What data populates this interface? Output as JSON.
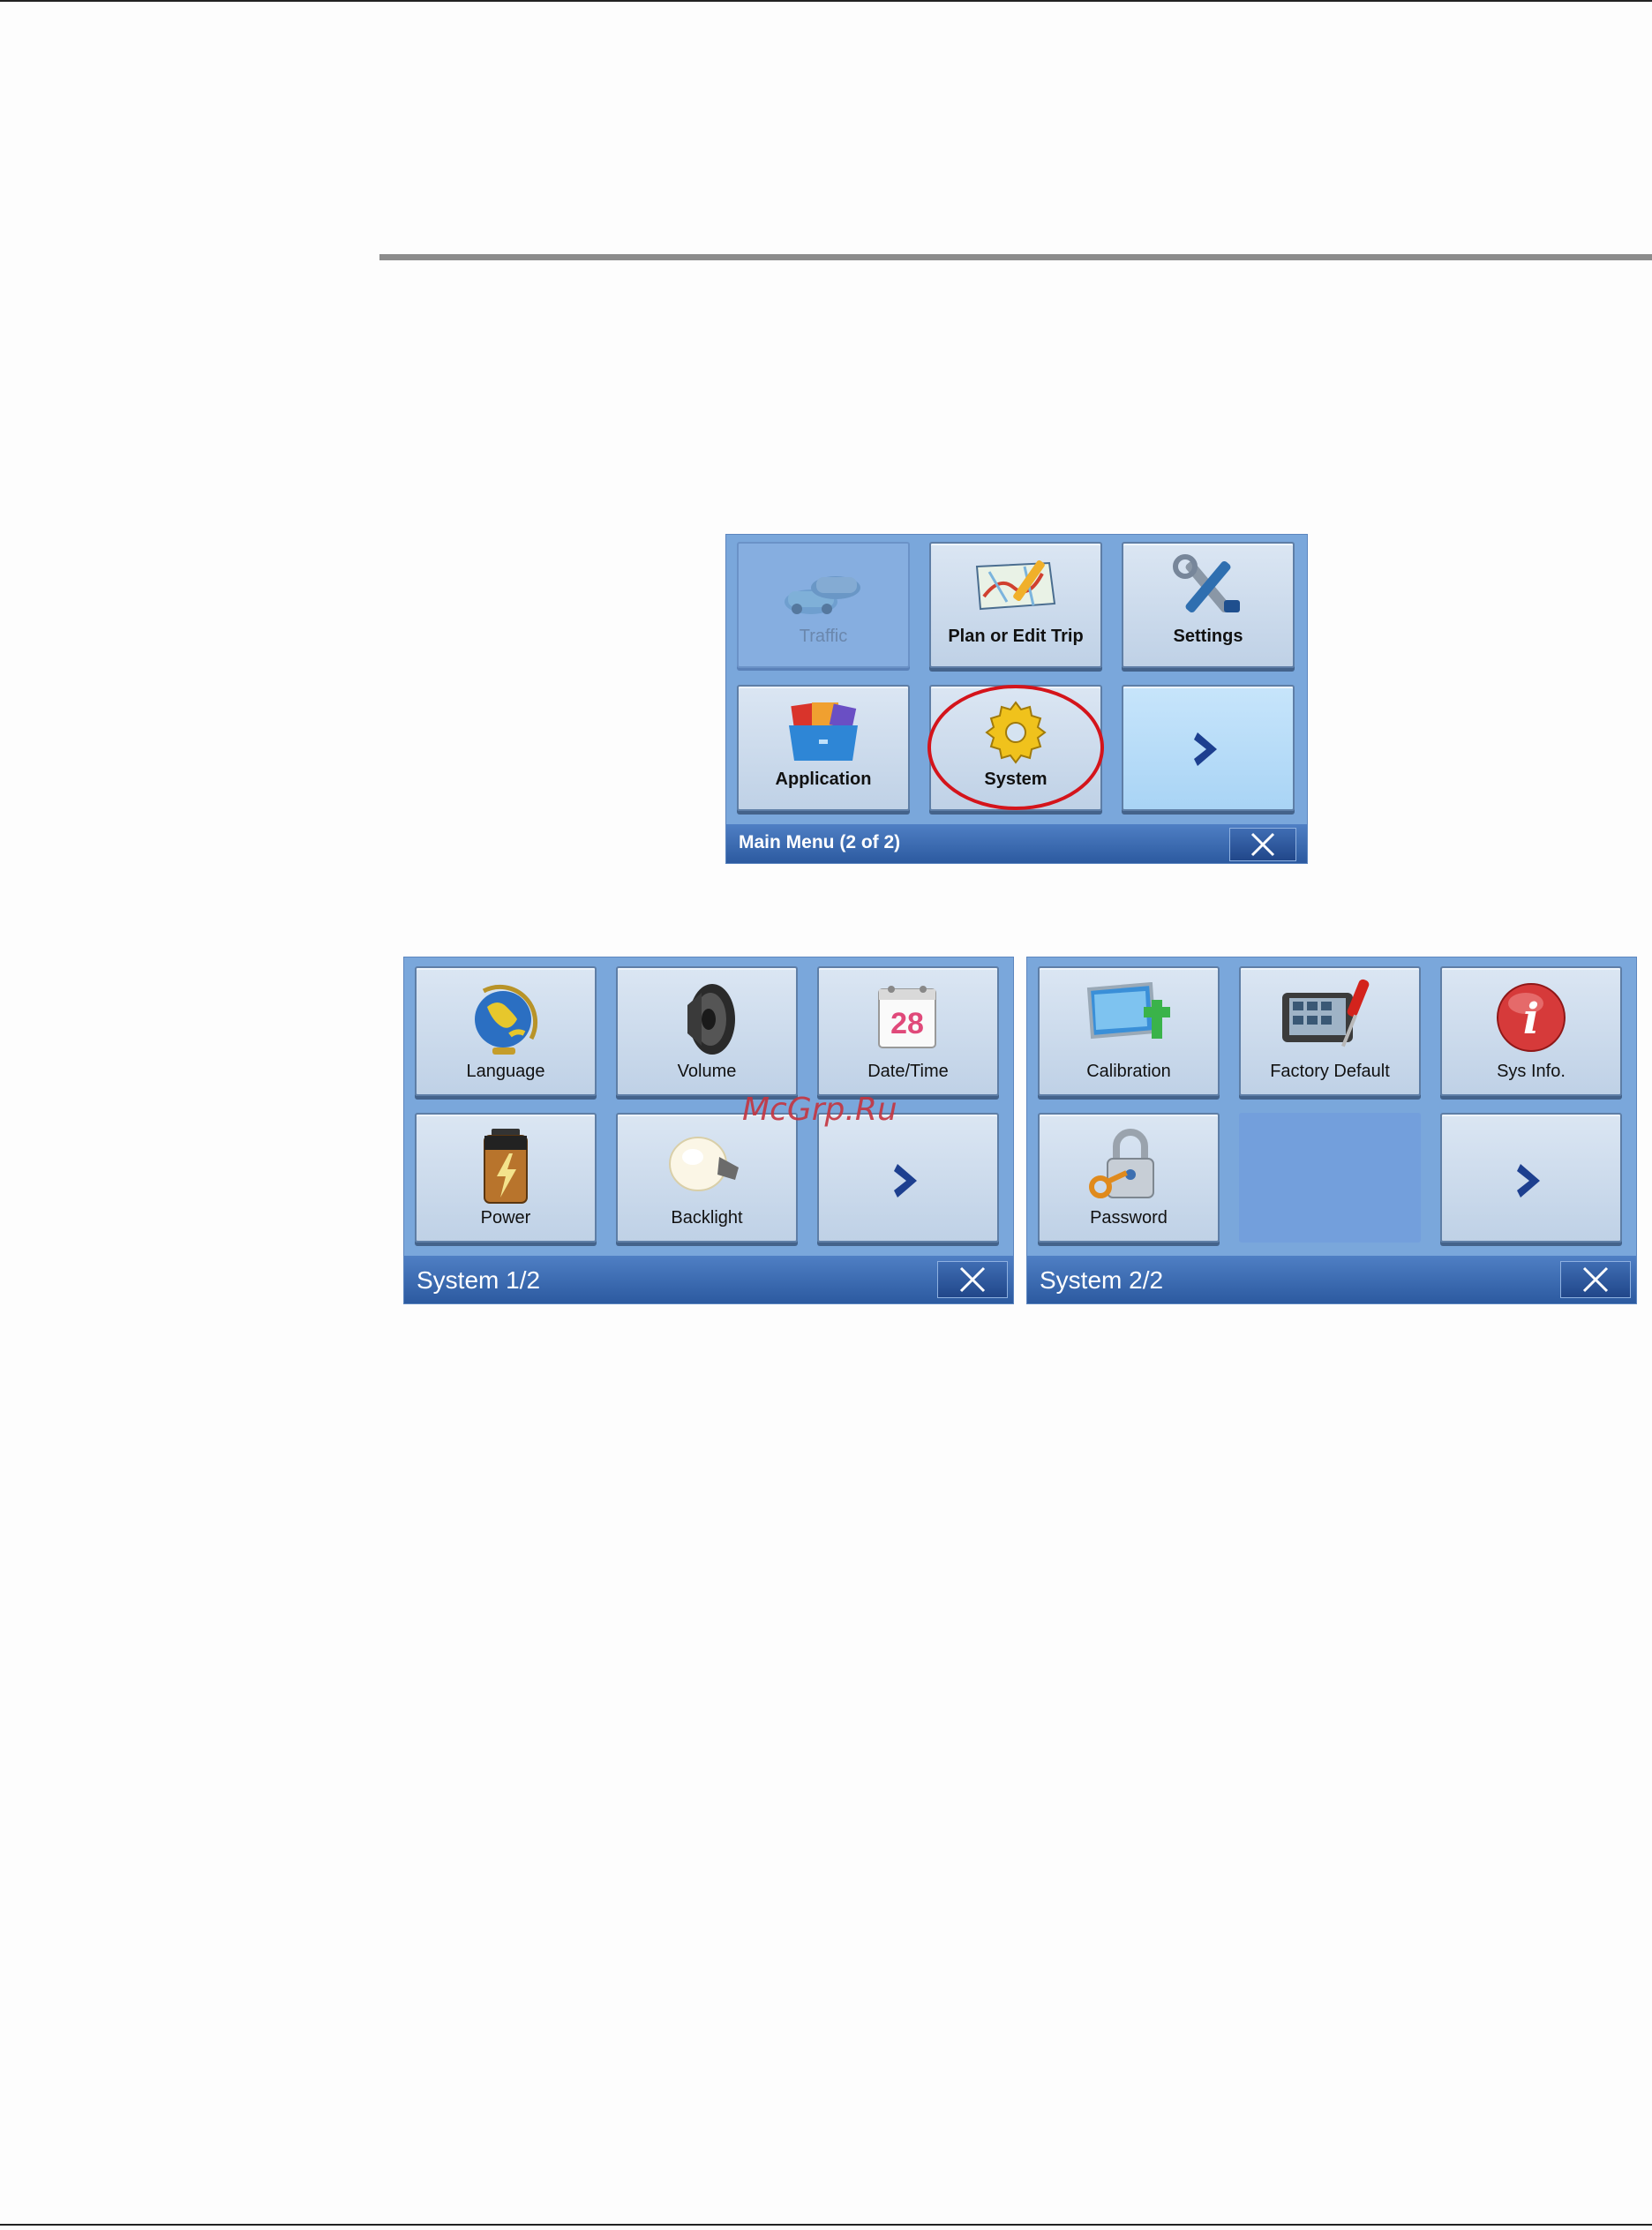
{
  "main_menu": {
    "tiles": [
      {
        "label": "Traffic",
        "icon": "traffic-cars-icon",
        "enabled": false
      },
      {
        "label": "Plan or Edit Trip",
        "icon": "map-pen-icon",
        "enabled": true
      },
      {
        "label": "Settings",
        "icon": "tools-icon",
        "enabled": true
      },
      {
        "label": "Application",
        "icon": "application-folder-icon",
        "enabled": true
      },
      {
        "label": "System",
        "icon": "gear-icon",
        "enabled": true,
        "highlighted": true
      },
      {
        "label": "",
        "icon": "chevron-right-icon",
        "enabled": true
      }
    ],
    "title": "Main Menu (2 of 2)",
    "close_icon": "close-icon"
  },
  "system_1": {
    "tiles": [
      {
        "label": "Language",
        "icon": "globe-icon"
      },
      {
        "label": "Volume",
        "icon": "speaker-icon"
      },
      {
        "label": "Date/Time",
        "icon": "calendar-icon",
        "day": "28"
      },
      {
        "label": "Power",
        "icon": "battery-icon"
      },
      {
        "label": "Backlight",
        "icon": "light-bulb-icon"
      },
      {
        "label": "",
        "icon": "chevron-right-icon"
      }
    ],
    "title": "System 1/2"
  },
  "system_2": {
    "tiles": [
      {
        "label": "Calibration",
        "icon": "calibration-screen-icon"
      },
      {
        "label": "Factory Default",
        "icon": "device-screwdriver-icon"
      },
      {
        "label": "Sys Info.",
        "icon": "info-icon",
        "glyph": "i"
      },
      {
        "label": "Password",
        "icon": "padlock-key-icon"
      },
      {
        "label": "",
        "icon": ""
      },
      {
        "label": "",
        "icon": "chevron-right-icon"
      }
    ],
    "title": "System 2/2"
  },
  "watermark": "McGrp.Ru",
  "colors": {
    "screen_bg": "#7aa7db",
    "title_bar": "#2c5aa0",
    "chevron": "#1d3f8f",
    "highlight_ring": "#d4141b"
  }
}
